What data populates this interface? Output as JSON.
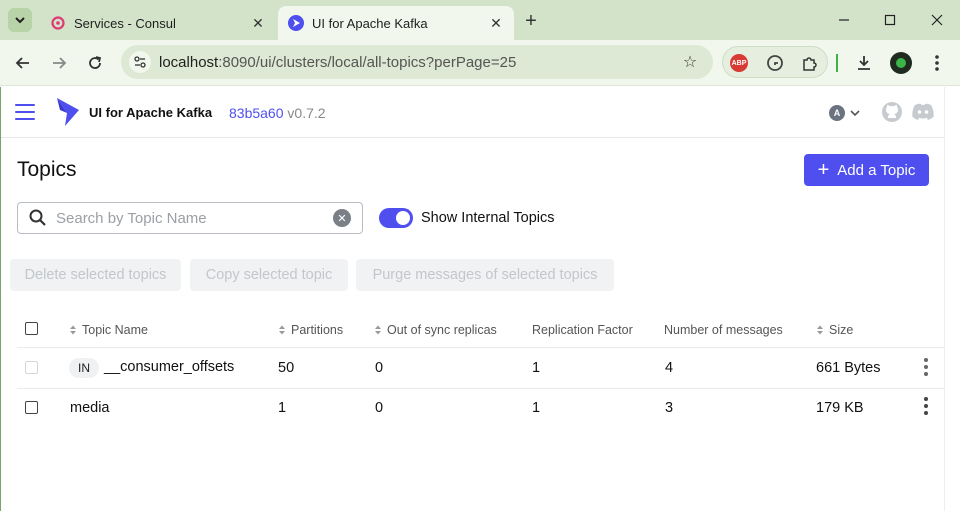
{
  "browser": {
    "tabs": [
      {
        "title": "Services - Consul",
        "active": false
      },
      {
        "title": "UI for Apache Kafka",
        "active": true
      }
    ],
    "url_host": "localhost",
    "url_path": ":8090/ui/clusters/local/all-topics?perPage=25",
    "extension_abp_label": "ABP"
  },
  "header": {
    "app_name": "UI for Apache Kafka",
    "commit": "83b5a60",
    "version": "v0.7.2",
    "user_initial": "A"
  },
  "page": {
    "title": "Topics",
    "add_button": "Add a Topic",
    "search_placeholder": "Search by Topic Name",
    "toggle_label": "Show Internal Topics",
    "toggle_on": true,
    "bulk_actions": [
      "Delete selected topics",
      "Copy selected topic",
      "Purge messages of selected topics"
    ]
  },
  "table": {
    "columns": [
      "Topic Name",
      "Partitions",
      "Out of sync replicas",
      "Replication Factor",
      "Number of messages",
      "Size"
    ],
    "rows": [
      {
        "internal_badge": "IN",
        "name": "__consumer_offsets",
        "partitions": "50",
        "out_of_sync": "0",
        "replication": "1",
        "messages": "4",
        "size": "661 Bytes"
      },
      {
        "internal_badge": "",
        "name": "media",
        "partitions": "1",
        "out_of_sync": "0",
        "replication": "1",
        "messages": "3",
        "size": "179 KB"
      }
    ]
  },
  "colors": {
    "accent": "#4f4ff0",
    "tabstrip": "#d3e3c9",
    "toolbar": "#f1f7ec"
  }
}
